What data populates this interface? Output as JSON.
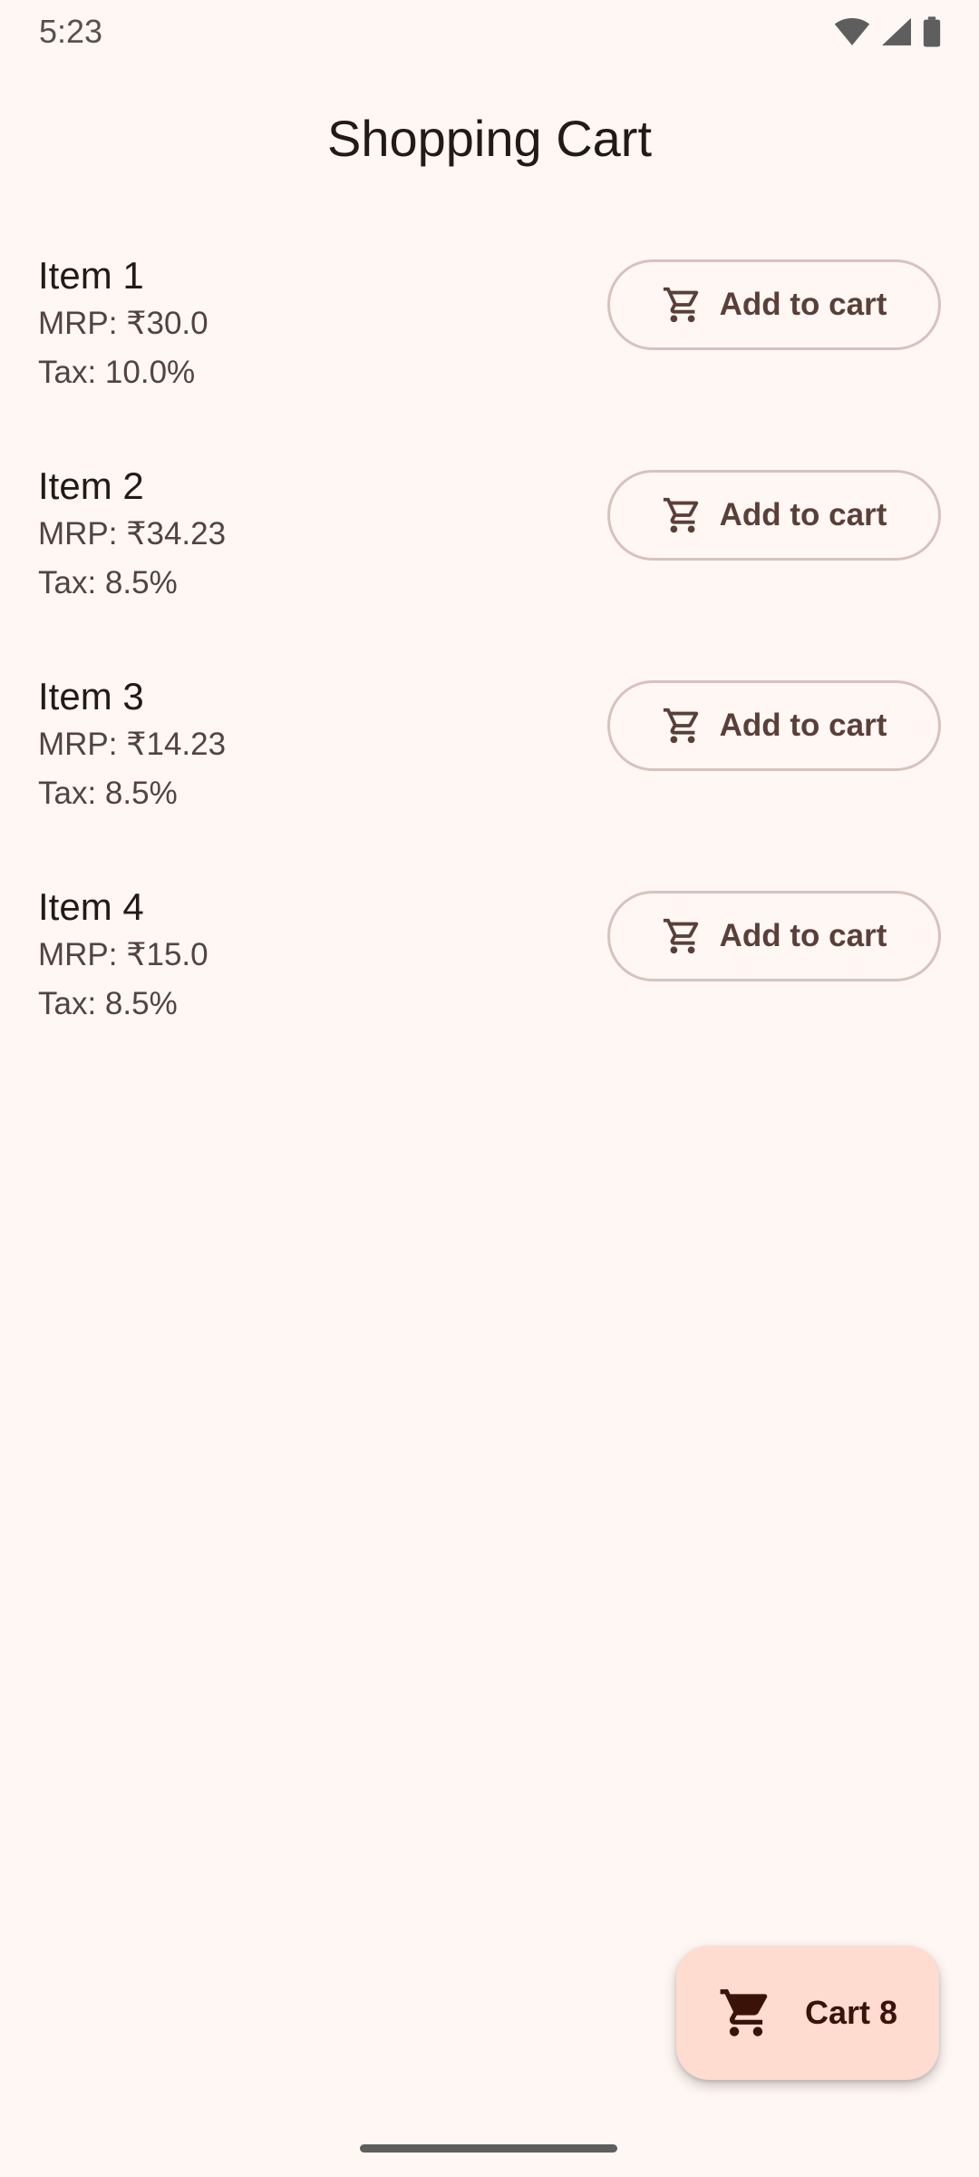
{
  "status_bar": {
    "time": "5:23",
    "icons": [
      "wifi-icon",
      "cellular-signal-icon",
      "battery-icon"
    ]
  },
  "page": {
    "title": "Shopping Cart"
  },
  "items": [
    {
      "name": "Item 1",
      "mrp": "MRP: ₹30.0",
      "tax": "Tax: 10.0%",
      "button_label": "Add to cart"
    },
    {
      "name": "Item 2",
      "mrp": "MRP: ₹34.23",
      "tax": "Tax: 8.5%",
      "button_label": "Add to cart"
    },
    {
      "name": "Item 3",
      "mrp": "MRP: ₹14.23",
      "tax": "Tax: 8.5%",
      "button_label": "Add to cart"
    },
    {
      "name": "Item 4",
      "mrp": "MRP: ₹15.0",
      "tax": "Tax: 8.5%",
      "button_label": "Add to cart"
    }
  ],
  "fab": {
    "label": "Cart 8",
    "icon": "shopping-cart-icon"
  },
  "colors": {
    "background": "#FFF7F4",
    "fab_background": "#FFDBD0",
    "button_border": "#D8C2BD",
    "button_text": "#5A3F38"
  }
}
